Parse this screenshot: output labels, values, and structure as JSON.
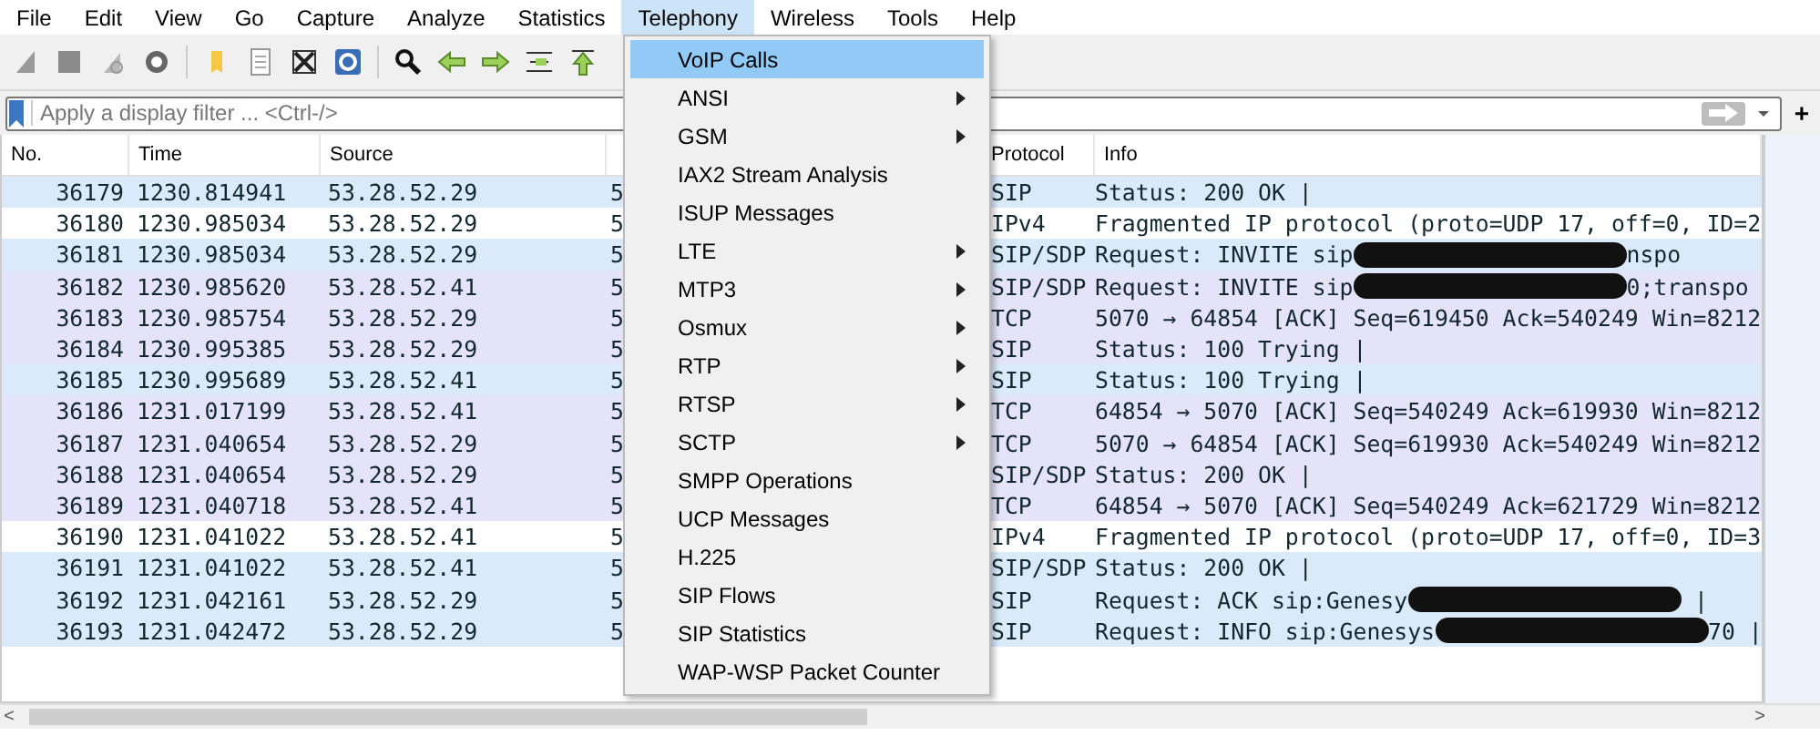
{
  "menubar": [
    {
      "label": "File",
      "selected": false
    },
    {
      "label": "Edit",
      "selected": false
    },
    {
      "label": "View",
      "selected": false
    },
    {
      "label": "Go",
      "selected": false
    },
    {
      "label": "Capture",
      "selected": false
    },
    {
      "label": "Analyze",
      "selected": false
    },
    {
      "label": "Statistics",
      "selected": false
    },
    {
      "label": "Telephony",
      "selected": true
    },
    {
      "label": "Wireless",
      "selected": false
    },
    {
      "label": "Tools",
      "selected": false
    },
    {
      "label": "Help",
      "selected": false
    }
  ],
  "filter": {
    "placeholder": "Apply a display filter ... <Ctrl-/>",
    "add": "+"
  },
  "table": {
    "columns": [
      "No.",
      "Time",
      "Source",
      "",
      "Protocol",
      "Info"
    ],
    "rows": [
      {
        "no": "36179",
        "time": "1230.814941",
        "source": "53.28.52.29",
        "destination": "5",
        "protocol": "SIP",
        "info": "Status: 200 OK |",
        "color": "#dbeafb"
      },
      {
        "no": "36180",
        "time": "1230.985034",
        "source": "53.28.52.29",
        "destination": "5",
        "protocol": "IPv4",
        "info": "Fragmented IP protocol (proto=UDP 17, off=0, ID=2",
        "color": "#ffffff"
      },
      {
        "no": "36181",
        "time": "1230.985034",
        "source": "53.28.52.29",
        "destination": "5",
        "protocol": "SIP/SDP",
        "info": "Request: INVITE sip",
        "info_end": "nspo",
        "color": "#dbeafb"
      },
      {
        "no": "36182",
        "time": "1230.985620",
        "source": "53.28.52.41",
        "destination": "5",
        "protocol": "SIP/SDP",
        "info": "Request: INVITE sip",
        "info_end": "0;transpo",
        "color": "#e4e3fa"
      },
      {
        "no": "36183",
        "time": "1230.985754",
        "source": "53.28.52.29",
        "destination": "5",
        "protocol": "TCP",
        "info": "5070 → 64854 [ACK] Seq=619450 Ack=540249 Win=8212",
        "color": "#e4e3fa"
      },
      {
        "no": "36184",
        "time": "1230.995385",
        "source": "53.28.52.29",
        "destination": "5",
        "protocol": "SIP",
        "info": "Status: 100 Trying |",
        "color": "#e4e3fa"
      },
      {
        "no": "36185",
        "time": "1230.995689",
        "source": "53.28.52.41",
        "destination": "5",
        "protocol": "SIP",
        "info": "Status: 100 Trying |",
        "color": "#dbeafb"
      },
      {
        "no": "36186",
        "time": "1231.017199",
        "source": "53.28.52.41",
        "destination": "5",
        "protocol": "TCP",
        "info": "64854 → 5070 [ACK] Seq=540249 Ack=619930 Win=8212",
        "color": "#e4e3fa"
      },
      {
        "no": "36187",
        "time": "1231.040654",
        "source": "53.28.52.29",
        "destination": "5",
        "protocol": "TCP",
        "info": "5070 → 64854 [ACK] Seq=619930 Ack=540249 Win=8212",
        "color": "#e4e3fa"
      },
      {
        "no": "36188",
        "time": "1231.040654",
        "source": "53.28.52.29",
        "destination": "5",
        "protocol": "SIP/SDP",
        "info": "Status: 200 OK |",
        "color": "#e4e3fa"
      },
      {
        "no": "36189",
        "time": "1231.040718",
        "source": "53.28.52.41",
        "destination": "5",
        "protocol": "TCP",
        "info": "64854 → 5070 [ACK] Seq=540249 Ack=621729 Win=8212",
        "color": "#e4e3fa"
      },
      {
        "no": "36190",
        "time": "1231.041022",
        "source": "53.28.52.41",
        "destination": "5",
        "protocol": "IPv4",
        "info": "Fragmented IP protocol (proto=UDP 17, off=0, ID=3",
        "color": "#ffffff"
      },
      {
        "no": "36191",
        "time": "1231.041022",
        "source": "53.28.52.41",
        "destination": "5",
        "protocol": "SIP/SDP",
        "info": "Status: 200 OK |",
        "color": "#dbeafb"
      },
      {
        "no": "36192",
        "time": "1231.042161",
        "source": "53.28.52.29",
        "destination": "5",
        "protocol": "SIP",
        "info": "Request: ACK sip:Genesy",
        "info_end": " |",
        "color": "#dbeafb"
      },
      {
        "no": "36193",
        "time": "1231.042472",
        "source": "53.28.52.29",
        "destination": "5",
        "protocol": "SIP",
        "info": "Request: INFO sip:Genesys",
        "info_end": "70 |",
        "color": "#dbeafb"
      }
    ]
  },
  "scrollbar": {
    "left": "<",
    "right": ">"
  },
  "telephony_menu": [
    {
      "label": "VoIP Calls",
      "submenu": false,
      "selected": true
    },
    {
      "label": "ANSI",
      "submenu": true,
      "selected": false
    },
    {
      "label": "GSM",
      "submenu": true,
      "selected": false
    },
    {
      "label": "IAX2 Stream Analysis",
      "submenu": false,
      "selected": false
    },
    {
      "label": "ISUP Messages",
      "submenu": false,
      "selected": false
    },
    {
      "label": "LTE",
      "submenu": true,
      "selected": false
    },
    {
      "label": "MTP3",
      "submenu": true,
      "selected": false
    },
    {
      "label": "Osmux",
      "submenu": true,
      "selected": false
    },
    {
      "label": "RTP",
      "submenu": true,
      "selected": false
    },
    {
      "label": "RTSP",
      "submenu": true,
      "selected": false
    },
    {
      "label": "SCTP",
      "submenu": true,
      "selected": false
    },
    {
      "label": "SMPP Operations",
      "submenu": false,
      "selected": false
    },
    {
      "label": "UCP Messages",
      "submenu": false,
      "selected": false
    },
    {
      "label": "H.225",
      "submenu": false,
      "selected": false
    },
    {
      "label": "SIP Flows",
      "submenu": false,
      "selected": false
    },
    {
      "label": "SIP Statistics",
      "submenu": false,
      "selected": false
    },
    {
      "label": "WAP-WSP Packet Counter",
      "submenu": false,
      "selected": false
    }
  ]
}
